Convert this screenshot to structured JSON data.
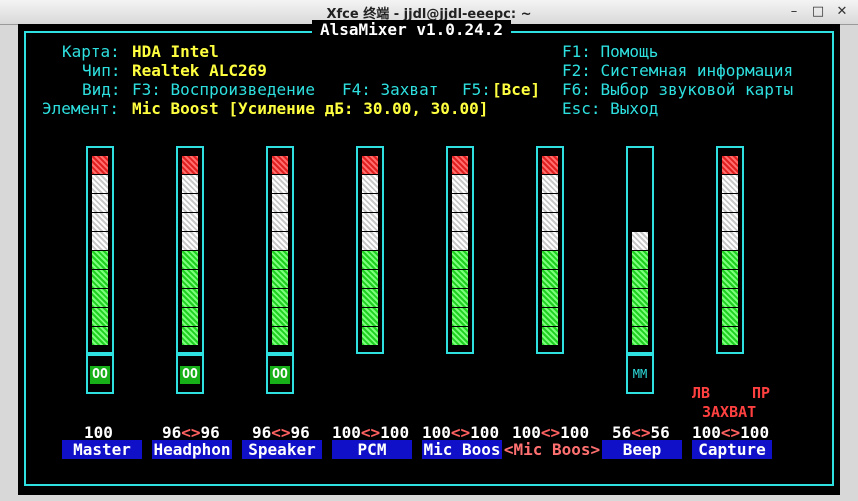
{
  "window": {
    "title": "Xfce 终端 - jjdl@jjdl-eeepc: ~",
    "minimize": "–",
    "maximize": "□",
    "close": "✕"
  },
  "app_title": "AlsaMixer v1.0.24.2",
  "info": {
    "card_label": "Карта:",
    "card_value": "HDA Intel",
    "chip_label": "Чип:",
    "chip_value": "Realtek ALC269",
    "view_label": "Вид:",
    "view_f3": "F3: Воспроизведение",
    "view_f4": "F4: Захват",
    "view_f5": "F5:",
    "view_f5_value": "[Все]",
    "element_label": "Элемент:",
    "element_value": "Mic Boost [Усиление дБ: 30.00, 30.00]"
  },
  "help": {
    "f1": "F1: Помощь",
    "f2": "F2: Системная информация",
    "f6": "F6: Выбор звуковой карты",
    "esc": "Esc: Выход"
  },
  "capture_labels": {
    "left": "ЛВ",
    "right": "ПР",
    "capture": "ЗАХВАТ"
  },
  "channels": [
    {
      "name": "Master",
      "level": "100",
      "left": "",
      "sep": "",
      "right": "",
      "fill": 100,
      "switch": "OO",
      "active": false
    },
    {
      "name": "Headphon",
      "level": "",
      "left": "96",
      "sep": "<>",
      "right": "96",
      "fill": 96,
      "switch": "OO",
      "active": false
    },
    {
      "name": "Speaker",
      "level": "",
      "left": "96",
      "sep": "<>",
      "right": "96",
      "fill": 96,
      "switch": "OO",
      "active": false
    },
    {
      "name": "PCM",
      "level": "",
      "left": "100",
      "sep": "<>",
      "right": "100",
      "fill": 100,
      "switch": "",
      "active": false
    },
    {
      "name": "Mic Boos",
      "level": "",
      "left": "100",
      "sep": "<>",
      "right": "100",
      "fill": 100,
      "switch": "",
      "active": false
    },
    {
      "name": "<Mic Boos>",
      "level": "",
      "left": "100",
      "sep": "<>",
      "right": "100",
      "fill": 100,
      "switch": "",
      "active": true
    },
    {
      "name": "Beep",
      "level": "",
      "left": "56",
      "sep": "<>",
      "right": "56",
      "fill": 56,
      "switch": "MM",
      "active": false
    },
    {
      "name": "Capture",
      "level": "",
      "left": "100",
      "sep": "<>",
      "right": "100",
      "fill": 100,
      "switch": "",
      "active": false
    }
  ],
  "colors": {
    "border": "#2ee0e0",
    "label": "#2ee0e0",
    "value": "#ffff40",
    "name_bg": "#1010c8",
    "active_name": "#ff7070"
  }
}
